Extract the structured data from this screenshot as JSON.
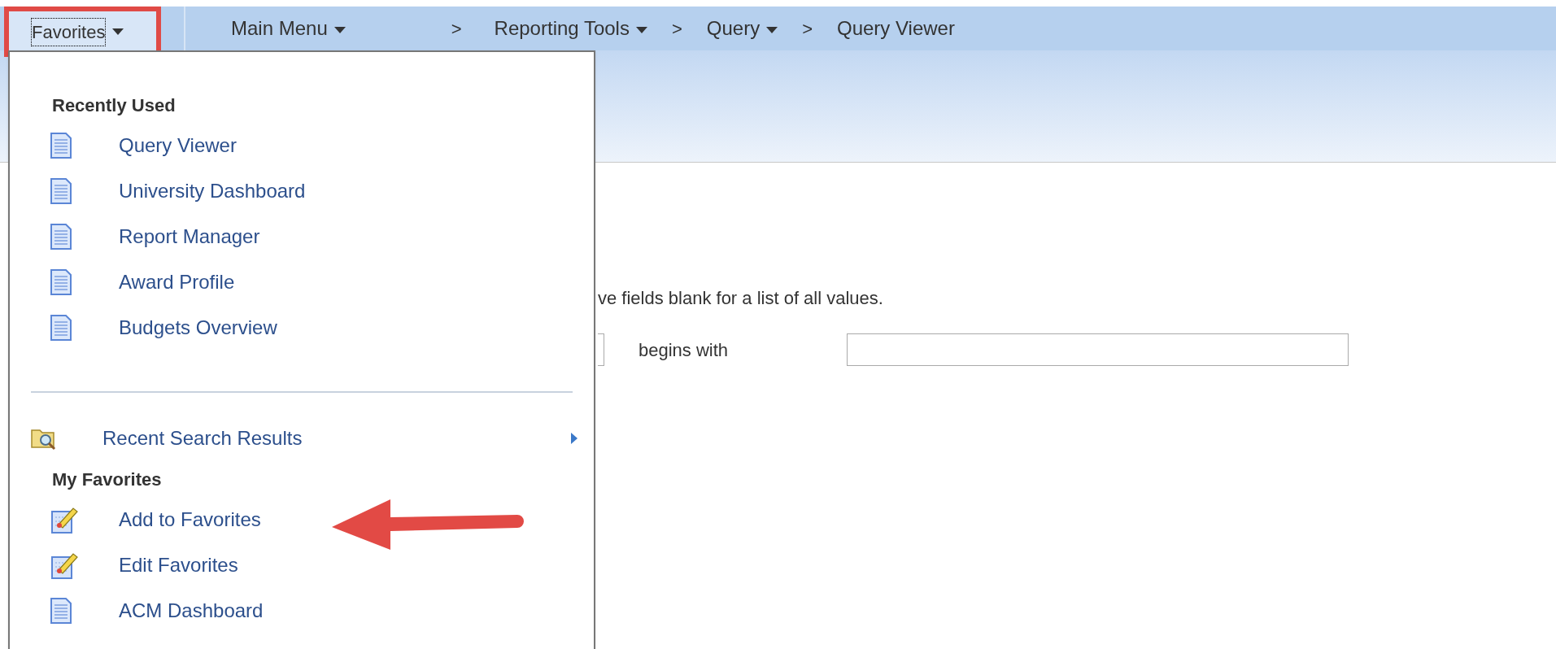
{
  "nav_bar": {
    "favorites": {
      "label": "Favorites",
      "highlighted": true
    },
    "breadcrumb": [
      {
        "label": "Main Menu",
        "dropdown": true
      },
      {
        "separator": ">",
        "label": "Reporting Tools",
        "dropdown": true
      },
      {
        "separator": ">",
        "label": "Query",
        "dropdown": true
      },
      {
        "separator": ">",
        "label": "Query Viewer",
        "dropdown": false
      }
    ]
  },
  "favorites_menu": {
    "sections": [
      {
        "heading": "Recently Used",
        "items": [
          {
            "kind": "page",
            "label": "Query Viewer"
          },
          {
            "kind": "page",
            "label": "University Dashboard"
          },
          {
            "kind": "page",
            "label": "Report Manager"
          },
          {
            "kind": "page",
            "label": "Award Profile"
          },
          {
            "kind": "page",
            "label": "Budgets Overview"
          }
        ]
      },
      {
        "items": [
          {
            "kind": "search",
            "label": "Recent Search Results",
            "has_submenu": true
          }
        ]
      },
      {
        "heading": "My Favorites",
        "items": [
          {
            "kind": "edit",
            "label": "Add to Favorites",
            "pointed_at": true
          },
          {
            "kind": "edit",
            "label": "Edit Favorites"
          },
          {
            "kind": "page",
            "label": "ACM Dashboard"
          }
        ]
      }
    ]
  },
  "search_form": {
    "instruction": "ve fields blank for a list of all values.",
    "operator": "begins with"
  }
}
